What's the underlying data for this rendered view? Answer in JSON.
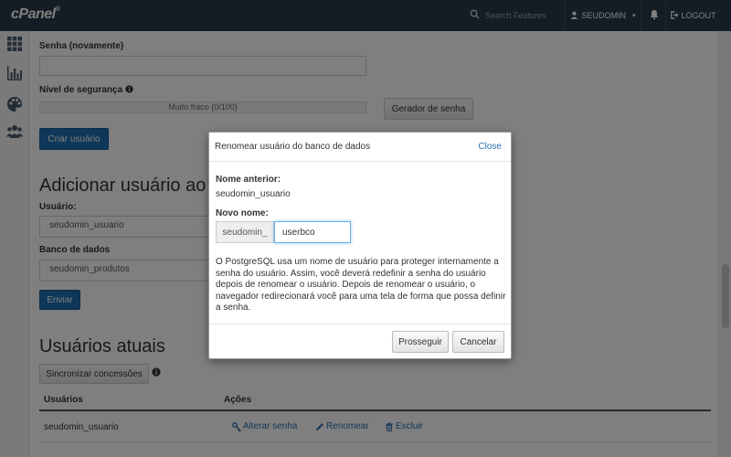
{
  "header": {
    "logo_text": "cPanel",
    "logo_mark": "®",
    "search_placeholder": "Search Features",
    "user_label": "SEUDOMIN",
    "caret": "▾",
    "logout_label": "LOGOUT",
    "bg_color": "#293a4a"
  },
  "sidebar": {
    "items": [
      {
        "icon": "grid-icon"
      },
      {
        "icon": "bar-chart-icon"
      },
      {
        "icon": "palette-icon"
      },
      {
        "icon": "users-icon"
      }
    ]
  },
  "page": {
    "password_again_label": "Senha (novamente)",
    "strength_label": "Nível de segurança",
    "strength_meter_text": "Muito fraco (0/100)",
    "strength_value_percent": 0,
    "generator_button": "Gerador de senha",
    "create_user_button": "Criar usuário",
    "add_user_heading": "Adicionar usuário ao",
    "user_label": "Usuário:",
    "user_select": "seudomin_usuario",
    "db_label": "Banco de dados",
    "db_select": "seudomin_produtos",
    "submit_button": "Enviar",
    "current_users_heading": "Usuários atuais",
    "sync_button": "Sincronizar concessões",
    "table": {
      "headers": [
        "Usuários",
        "Ações"
      ],
      "rows": [
        {
          "user": "seudomin_usuario",
          "actions": [
            "Alterar senha",
            "Renomear",
            "Excluir"
          ]
        }
      ]
    },
    "primary_color": "#1f6fb2",
    "link_color": "#2a6fb0"
  },
  "modal": {
    "title": "Renomear usuário do banco de dados",
    "close_label": "Close",
    "old_name_label": "Nome anterior:",
    "old_name_value": "seudomin_usuario",
    "new_name_label": "Novo nome:",
    "prefix": "seudomin_",
    "new_name_value": "userbco",
    "description": "O PostgreSQL usa um nome de usuário para proteger internamente a senha do usuário. Assim, você deverá redefinir a senha do usuário depois de renomear o usuário. Depois de renomear o usuário, o navegador redirecionará você para uma tela de forma que possa definir a senha.",
    "proceed_button": "Prosseguir",
    "cancel_button": "Cancelar"
  }
}
